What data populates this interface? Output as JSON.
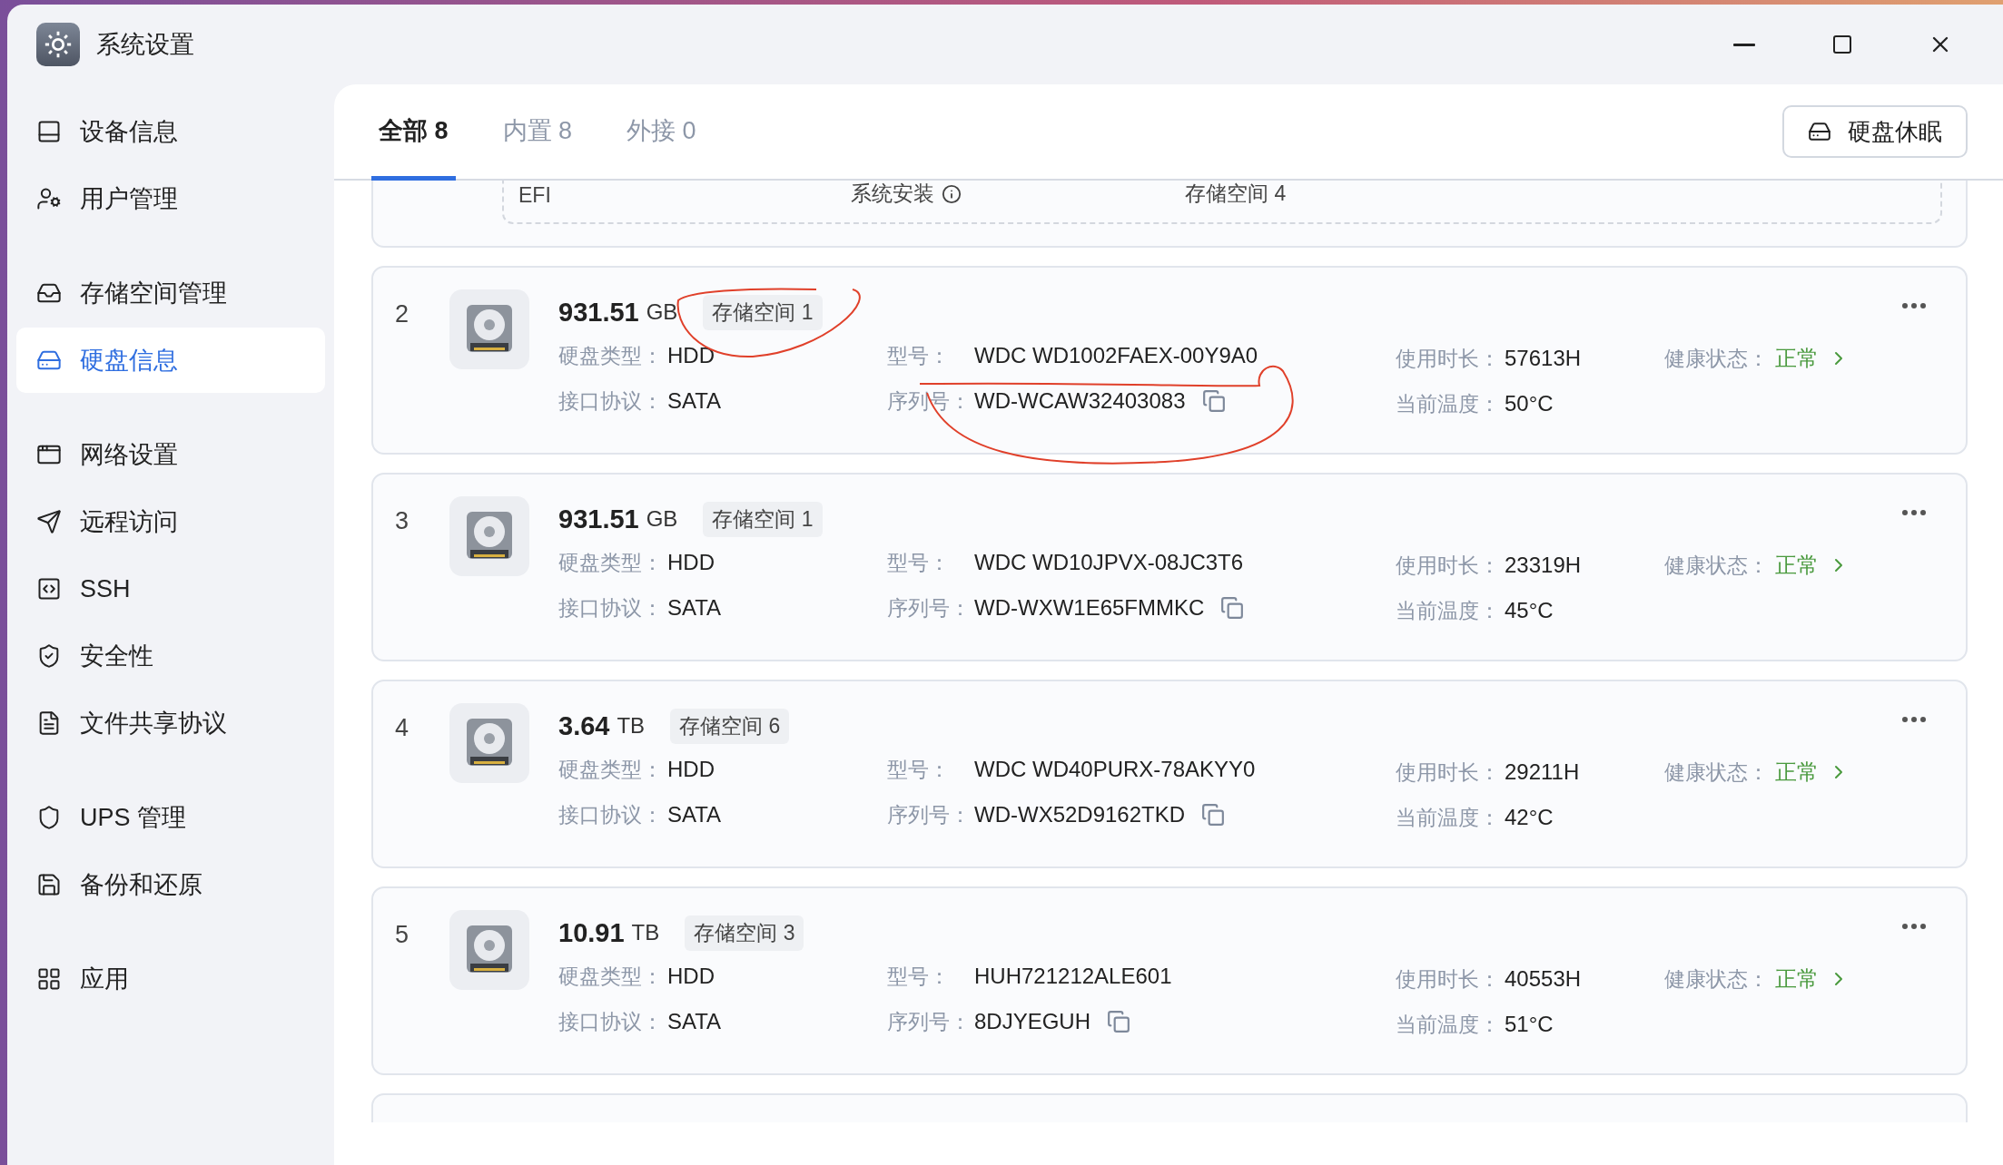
{
  "window": {
    "title": "系统设置"
  },
  "sidebar": {
    "groups": [
      {
        "items": [
          {
            "label": "设备信息",
            "selected": false
          },
          {
            "label": "用户管理",
            "selected": false
          }
        ]
      },
      {
        "items": [
          {
            "label": "存储空间管理",
            "selected": false
          },
          {
            "label": "硬盘信息",
            "selected": true
          }
        ]
      },
      {
        "items": [
          {
            "label": "网络设置",
            "selected": false
          },
          {
            "label": "远程访问",
            "selected": false
          },
          {
            "label": "SSH",
            "selected": false
          },
          {
            "label": "安全性",
            "selected": false
          },
          {
            "label": "文件共享协议",
            "selected": false
          }
        ]
      },
      {
        "items": [
          {
            "label": "UPS 管理",
            "selected": false
          },
          {
            "label": "备份和还原",
            "selected": false
          }
        ]
      },
      {
        "items": [
          {
            "label": "应用",
            "selected": false
          }
        ]
      }
    ]
  },
  "tabs": [
    {
      "label": "全部 8",
      "selected": true
    },
    {
      "label": "内置 8",
      "selected": false
    },
    {
      "label": "外接 0",
      "selected": false
    }
  ],
  "sleep_button": "硬盘休眠",
  "partial_disk": {
    "partitions": [
      {
        "label": "EFI",
        "info": false
      },
      {
        "label": "系统安装",
        "info": true
      },
      {
        "label": "存储空间 4",
        "info": false
      }
    ]
  },
  "disks": [
    {
      "index": "2",
      "size": "931.51",
      "unit": "GB",
      "pool": "存储空间 1",
      "circled_pool": true,
      "circled_serial": true,
      "fields": [
        {
          "label": "硬盘类型：",
          "value": "HDD"
        },
        {
          "label": "接口协议：",
          "value": "SATA"
        },
        {
          "label": "型号：",
          "value": "WDC WD1002FAEX-00Y9A0"
        },
        {
          "label": "序列号：",
          "value": "WD-WCAW32403083"
        },
        {
          "label": "使用时长：",
          "value": "57613H"
        },
        {
          "label": "当前温度：",
          "value": "50°C"
        },
        {
          "label": "健康状态：",
          "value": "正常"
        }
      ]
    },
    {
      "index": "3",
      "size": "931.51",
      "unit": "GB",
      "pool": "存储空间 1",
      "circled_pool": false,
      "circled_serial": false,
      "fields": [
        {
          "label": "硬盘类型：",
          "value": "HDD"
        },
        {
          "label": "接口协议：",
          "value": "SATA"
        },
        {
          "label": "型号：",
          "value": "WDC WD10JPVX-08JC3T6"
        },
        {
          "label": "序列号：",
          "value": "WD-WXW1E65FMMKC"
        },
        {
          "label": "使用时长：",
          "value": "23319H"
        },
        {
          "label": "当前温度：",
          "value": "45°C"
        },
        {
          "label": "健康状态：",
          "value": "正常"
        }
      ]
    },
    {
      "index": "4",
      "size": "3.64",
      "unit": "TB",
      "pool": "存储空间 6",
      "circled_pool": false,
      "circled_serial": false,
      "fields": [
        {
          "label": "硬盘类型：",
          "value": "HDD"
        },
        {
          "label": "接口协议：",
          "value": "SATA"
        },
        {
          "label": "型号：",
          "value": "WDC WD40PURX-78AKYY0"
        },
        {
          "label": "序列号：",
          "value": "WD-WX52D9162TKD"
        },
        {
          "label": "使用时长：",
          "value": "29211H"
        },
        {
          "label": "当前温度：",
          "value": "42°C"
        },
        {
          "label": "健康状态：",
          "value": "正常"
        }
      ]
    },
    {
      "index": "5",
      "size": "10.91",
      "unit": "TB",
      "pool": "存储空间 3",
      "circled_pool": false,
      "circled_serial": false,
      "fields": [
        {
          "label": "硬盘类型：",
          "value": "HDD"
        },
        {
          "label": "接口协议：",
          "value": "SATA"
        },
        {
          "label": "型号：",
          "value": "HUH721212ALE601"
        },
        {
          "label": "序列号：",
          "value": "8DJYEGUH"
        },
        {
          "label": "使用时长：",
          "value": "40553H"
        },
        {
          "label": "当前温度：",
          "value": "51°C"
        },
        {
          "label": "健康状态：",
          "value": "正常"
        }
      ]
    }
  ]
}
